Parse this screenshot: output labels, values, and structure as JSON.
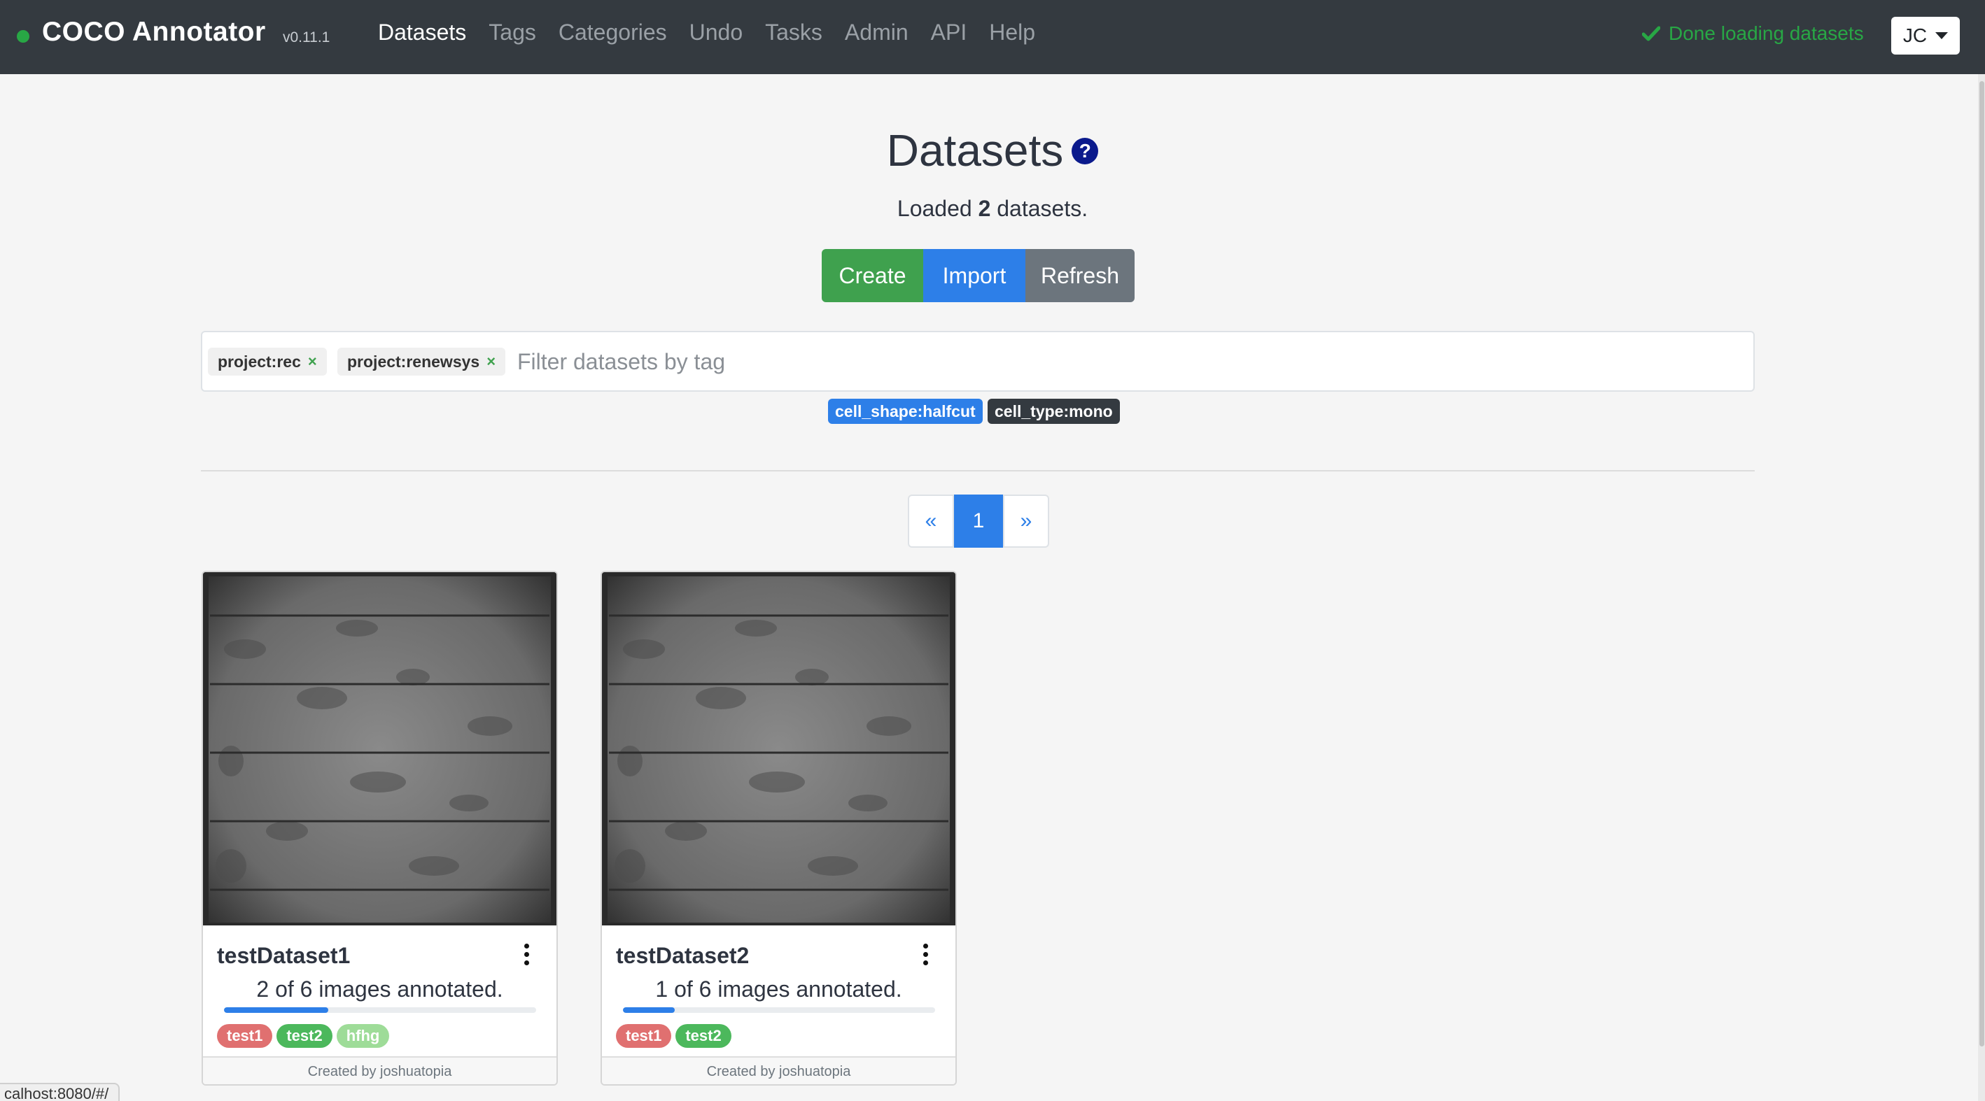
{
  "navbar": {
    "brand": "COCO Annotator",
    "version": "v0.11.1",
    "links": [
      "Datasets",
      "Tags",
      "Categories",
      "Undo",
      "Tasks",
      "Admin",
      "API",
      "Help"
    ],
    "active_link": "Datasets",
    "status": "Done loading datasets",
    "user": "JC"
  },
  "header": {
    "title": "Datasets",
    "help_glyph": "?",
    "loaded_prefix": "Loaded",
    "loaded_count": "2",
    "loaded_suffix": "datasets."
  },
  "actions": {
    "create": "Create",
    "import": "Import",
    "refresh": "Refresh"
  },
  "filter": {
    "chips": [
      "project:rec",
      "project:renewsys"
    ],
    "remove_glyph": "×",
    "placeholder": "Filter datasets by tag",
    "value": ""
  },
  "suggested_tags": [
    {
      "label": "cell_shape:halfcut",
      "color": "#2d7fe8"
    },
    {
      "label": "cell_type:mono",
      "color": "#343a40"
    }
  ],
  "pagination": {
    "prev": "«",
    "current": "1",
    "next": "»"
  },
  "datasets": [
    {
      "name": "testDataset1",
      "progress_text": "2 of 6 images annotated.",
      "annotated": 2,
      "total": 6,
      "tags": [
        {
          "label": "test1",
          "color": "#e07070"
        },
        {
          "label": "test2",
          "color": "#4cb85c"
        },
        {
          "label": "hfhg",
          "color": "#9edc98"
        }
      ],
      "footer": "Created by joshuatopia"
    },
    {
      "name": "testDataset2",
      "progress_text": "1 of 6 images annotated.",
      "annotated": 1,
      "total": 6,
      "tags": [
        {
          "label": "test1",
          "color": "#e07070"
        },
        {
          "label": "test2",
          "color": "#4cb85c"
        }
      ],
      "footer": "Created by joshuatopia"
    }
  ],
  "statusbar": {
    "url": "calhost:8080/#/"
  }
}
